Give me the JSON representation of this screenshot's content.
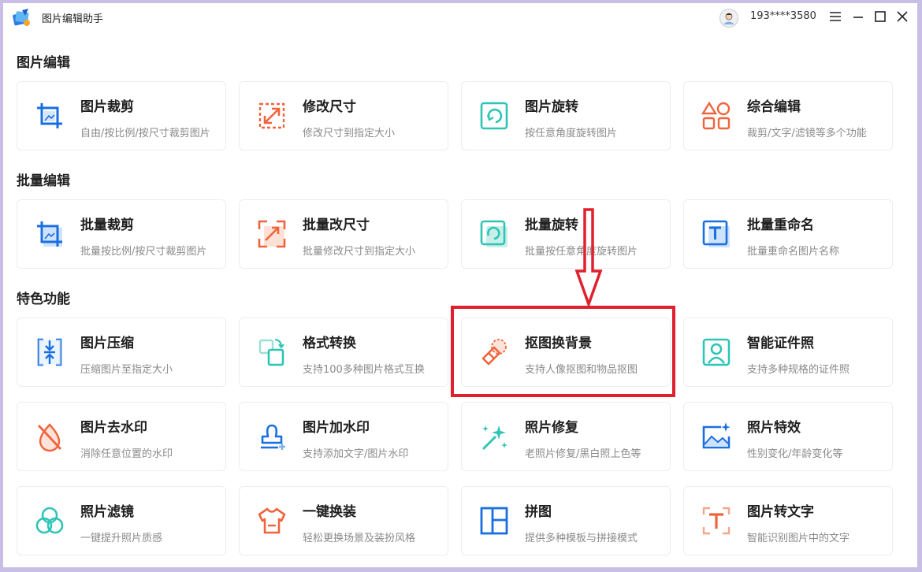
{
  "app": {
    "title": "图片编辑助手",
    "user": "193****3580"
  },
  "sections": [
    {
      "title": "图片编辑",
      "cards": [
        {
          "title": "图片裁剪",
          "desc": "自由/按比例/按尺寸裁剪图片",
          "icon": "crop-icon"
        },
        {
          "title": "修改尺寸",
          "desc": "修改尺寸到指定大小",
          "icon": "resize-icon"
        },
        {
          "title": "图片旋转",
          "desc": "按任意角度旋转图片",
          "icon": "rotate-icon"
        },
        {
          "title": "综合编辑",
          "desc": "裁剪/文字/滤镜等多个功能",
          "icon": "shapes-icon"
        }
      ]
    },
    {
      "title": "批量编辑",
      "cards": [
        {
          "title": "批量裁剪",
          "desc": "批量按比例/按尺寸裁剪图片",
          "icon": "batch-crop-icon"
        },
        {
          "title": "批量改尺寸",
          "desc": "批量修改尺寸到指定大小",
          "icon": "batch-resize-icon"
        },
        {
          "title": "批量旋转",
          "desc": "批量按任意角度旋转图片",
          "icon": "batch-rotate-icon"
        },
        {
          "title": "批量重命名",
          "desc": "批量重命名图片名称",
          "icon": "rename-icon"
        }
      ]
    },
    {
      "title": "特色功能",
      "cards": [
        {
          "title": "图片压缩",
          "desc": "压缩图片至指定大小",
          "icon": "compress-icon"
        },
        {
          "title": "格式转换",
          "desc": "支持100多种图片格式互换",
          "icon": "convert-icon"
        },
        {
          "title": "抠图换背景",
          "desc": "支持人像抠图和物品抠图",
          "icon": "eraser-icon"
        },
        {
          "title": "智能证件照",
          "desc": "支持多种规格的证件照",
          "icon": "id-photo-icon"
        },
        {
          "title": "图片去水印",
          "desc": "消除任意位置的水印",
          "icon": "no-watermark-icon"
        },
        {
          "title": "图片加水印",
          "desc": "支持添加文字/图片水印",
          "icon": "stamp-icon"
        },
        {
          "title": "照片修复",
          "desc": "老照片修复/黑白照上色等",
          "icon": "magic-wand-icon"
        },
        {
          "title": "照片特效",
          "desc": "性别变化/年龄变化等",
          "icon": "image-effect-icon"
        },
        {
          "title": "照片滤镜",
          "desc": "一键提升照片质感",
          "icon": "filter-icon"
        },
        {
          "title": "一键换装",
          "desc": "轻松更换场景及装扮风格",
          "icon": "shirt-icon"
        },
        {
          "title": "拼图",
          "desc": "提供多种模板与拼接模式",
          "icon": "collage-icon"
        },
        {
          "title": "图片转文字",
          "desc": "智能识别图片中的文字",
          "icon": "ocr-icon"
        }
      ]
    }
  ],
  "colors": {
    "blue": "#1a6fe0",
    "orange": "#f0643c",
    "teal": "#2ec4b6",
    "highlight": "#e0202e"
  }
}
